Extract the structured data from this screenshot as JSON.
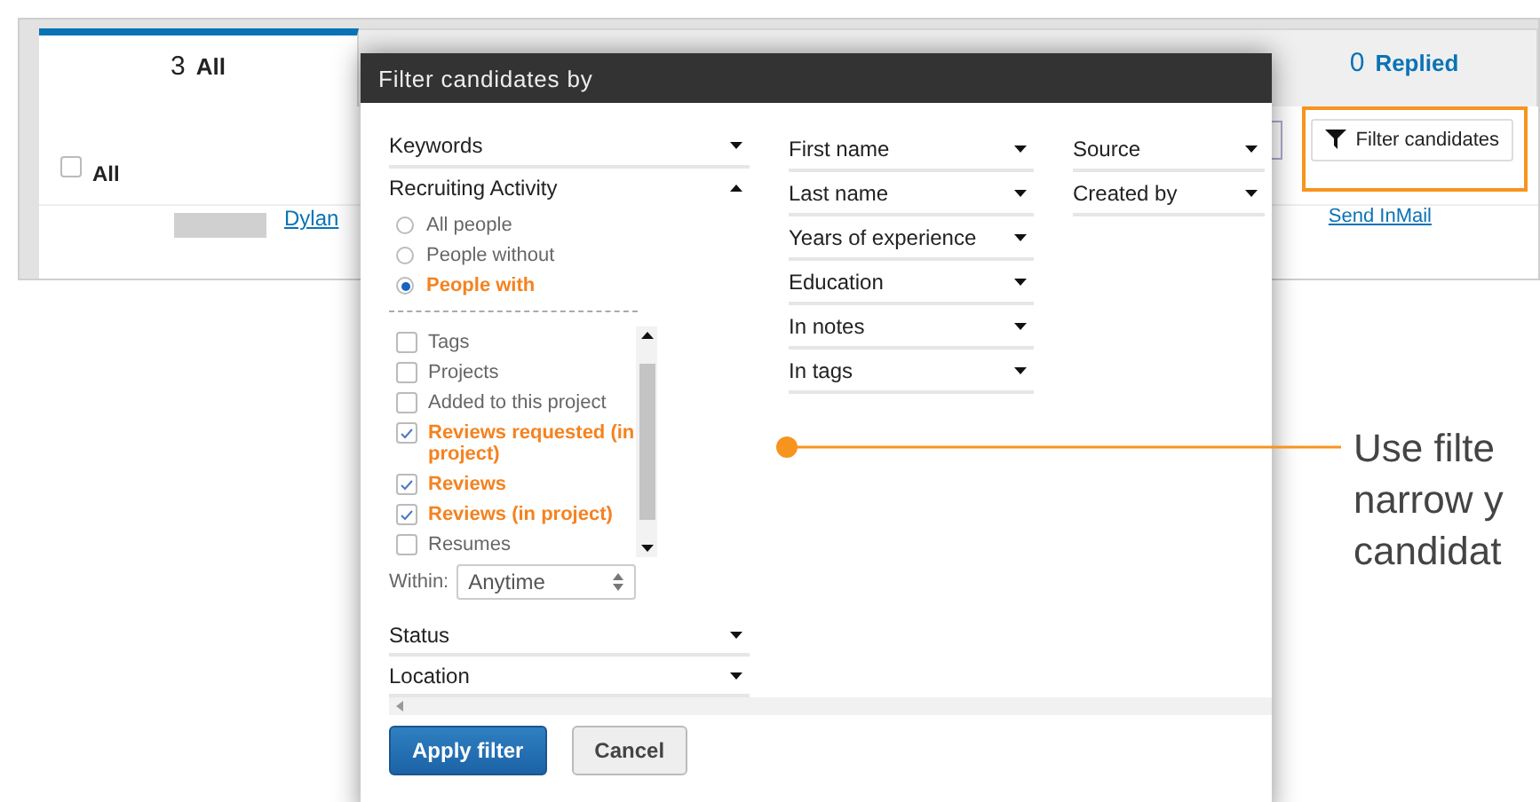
{
  "background_app": {
    "tabs": [
      {
        "count": "3",
        "label": "All",
        "selected": true
      },
      {
        "count": "0",
        "label": "Replied",
        "selected": false
      }
    ],
    "select_all": {
      "label": "All",
      "checked": false
    },
    "filter_button": {
      "label": "Filter candidates"
    },
    "candidate": {
      "name": "Dylan",
      "action": "Send InMail"
    }
  },
  "dialog": {
    "title": "Filter candidates by",
    "columns": [
      [
        {
          "label": "Keywords",
          "expanded": false
        },
        {
          "label": "Recruiting Activity",
          "expanded": true,
          "options": [
            {
              "label": "All people",
              "selected": false
            },
            {
              "label": "People without",
              "selected": false
            },
            {
              "label": "People with",
              "selected": true
            }
          ],
          "checklist": [
            {
              "label": "Tags",
              "checked": false
            },
            {
              "label": "Projects",
              "checked": false
            },
            {
              "label": "Added to this project",
              "checked": false
            },
            {
              "label": "Reviews requested (in project)",
              "checked": true
            },
            {
              "label": "Reviews",
              "checked": true
            },
            {
              "label": "Reviews (in project)",
              "checked": true
            },
            {
              "label": "Resumes",
              "checked": false
            }
          ],
          "within": {
            "label": "Within:",
            "value": "Anytime"
          }
        },
        {
          "label": "Status",
          "expanded": false
        },
        {
          "label": "Location",
          "expanded": false
        }
      ],
      [
        {
          "label": "First name",
          "expanded": false
        },
        {
          "label": "Last name",
          "expanded": false
        },
        {
          "label": "Years of experience",
          "expanded": false
        },
        {
          "label": "Education",
          "expanded": false
        },
        {
          "label": "In notes",
          "expanded": false
        },
        {
          "label": "In tags",
          "expanded": false
        }
      ],
      [
        {
          "label": "Source",
          "expanded": false
        },
        {
          "label": "Created by",
          "expanded": false
        }
      ]
    ],
    "buttons": [
      {
        "label": "Apply filter",
        "kind": "primary"
      },
      {
        "label": "Cancel",
        "kind": "secondary"
      }
    ]
  },
  "callout": {
    "lines": [
      "Use filte",
      "narrow y",
      "candidat"
    ]
  }
}
